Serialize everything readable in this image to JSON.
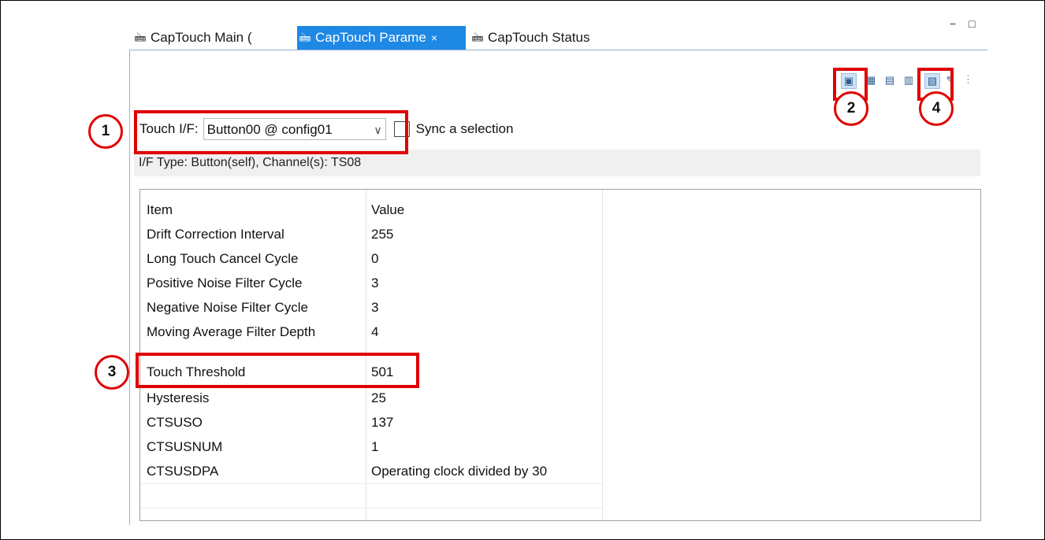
{
  "tabs": {
    "main": {
      "label": "CapTouch Main (",
      "icon": "captouch-icon"
    },
    "parameters": {
      "label": "CapTouch Parame",
      "icon": "captouch-icon",
      "close": "×"
    },
    "status": {
      "label": "CapTouch Status",
      "icon": "captouch-icon"
    }
  },
  "window_controls": {
    "minimize": "▭",
    "maximize": "□"
  },
  "toolbar": {
    "icons": [
      "select-icon",
      "grid-icon",
      "monitor-icon",
      "export-icon",
      "import-icon",
      "pencil-icon"
    ],
    "overflow": "⋮"
  },
  "touch_if": {
    "label": "Touch I/F:",
    "selected": "Button00 @ config01",
    "arrow": "∨",
    "sync_label": "Sync a selection",
    "sync_checked": false
  },
  "if_type_text": "I/F Type: Button(self), Channel(s): TS08",
  "table": {
    "headers": [
      "Item",
      "Value"
    ],
    "rows": [
      {
        "item": "Drift Correction Interval",
        "value": "255"
      },
      {
        "item": "Long Touch Cancel Cycle",
        "value": "0"
      },
      {
        "item": "Positive Noise Filter Cycle",
        "value": "3"
      },
      {
        "item": "Negative Noise Filter Cycle",
        "value": "3"
      },
      {
        "item": "Moving Average Filter Depth",
        "value": "4"
      },
      {
        "item": "Touch Threshold",
        "value": "501"
      },
      {
        "item": "Hysteresis",
        "value": "25"
      },
      {
        "item": "CTSUSO",
        "value": "137"
      },
      {
        "item": "CTSUSNUM",
        "value": "1"
      },
      {
        "item": "CTSUSDPA",
        "value": "Operating clock divided by 30"
      }
    ]
  },
  "annotations": {
    "n1": "1",
    "n2": "2",
    "n3": "3",
    "n4": "4"
  },
  "colors": {
    "accent": "#1e88e5",
    "callout": "#e00000"
  }
}
